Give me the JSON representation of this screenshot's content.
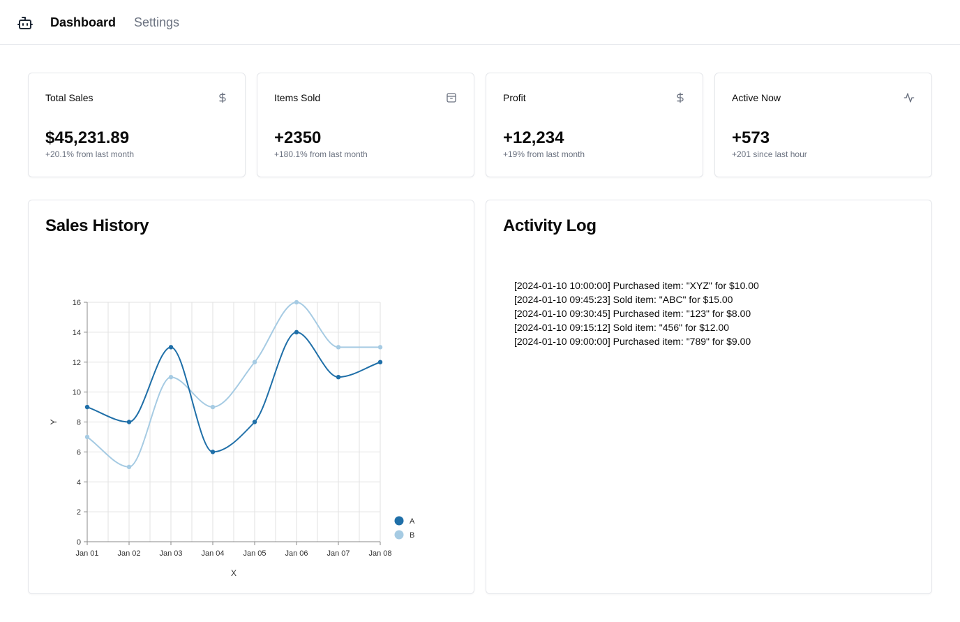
{
  "nav": {
    "logo_icon": "robot-icon",
    "items": [
      {
        "label": "Dashboard",
        "active": true
      },
      {
        "label": "Settings",
        "active": false
      }
    ]
  },
  "stats": [
    {
      "title": "Total Sales",
      "icon": "dollar-sign-icon",
      "value": "$45,231.89",
      "note": "+20.1% from last month"
    },
    {
      "title": "Items Sold",
      "icon": "package-icon",
      "value": "+2350",
      "note": "+180.1% from last month"
    },
    {
      "title": "Profit",
      "icon": "dollar-sign-icon",
      "value": "+12,234",
      "note": "+19% from last month"
    },
    {
      "title": "Active Now",
      "icon": "activity-icon",
      "value": "+573",
      "note": "+201 since last hour"
    }
  ],
  "sales_history": {
    "title": "Sales History"
  },
  "activity_log": {
    "title": "Activity Log",
    "entries": [
      "[2024-01-10 10:00:00] Purchased item: \"XYZ\" for $10.00",
      "[2024-01-10 09:45:23] Sold item: \"ABC\" for $15.00",
      "[2024-01-10 09:30:45] Purchased item: \"123\" for $8.00",
      "[2024-01-10 09:15:12] Sold item: \"456\" for $12.00",
      "[2024-01-10 09:00:00] Purchased item: \"789\" for $9.00"
    ]
  },
  "colors": {
    "series_a": "#1f6fa8",
    "series_b": "#a6cbe3",
    "grid": "#e2e2e2",
    "border": "#e5e7eb",
    "muted": "#6b7280"
  },
  "chart_data": {
    "type": "line",
    "categories": [
      "Jan 01",
      "Jan 02",
      "Jan 03",
      "Jan 04",
      "Jan 05",
      "Jan 06",
      "Jan 07",
      "Jan 08"
    ],
    "series": [
      {
        "name": "A",
        "values": [
          9,
          8,
          13,
          6,
          8,
          14,
          11,
          12
        ]
      },
      {
        "name": "B",
        "values": [
          7,
          5,
          11,
          9,
          12,
          16,
          13,
          13
        ]
      }
    ],
    "xlabel": "X",
    "ylabel": "Y",
    "ylim": [
      0,
      16
    ],
    "yticks": [
      0,
      2,
      4,
      6,
      8,
      10,
      12,
      14,
      16
    ],
    "grid": true,
    "curve": "smooth",
    "legend": "bottom-right"
  }
}
